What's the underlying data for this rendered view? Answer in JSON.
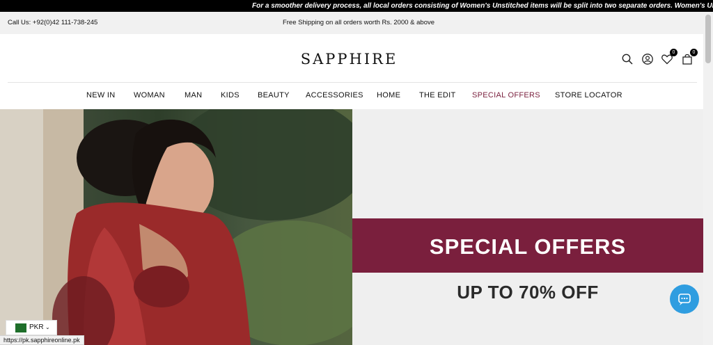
{
  "announcement": "For a smoother delivery process, all local orders consisting of Women's Unstitched items will be split into two separate orders. Women's Uns",
  "topbar": {
    "call": "Call Us: +92(0)42 111-738-245",
    "shipping": "Free Shipping on all orders worth Rs. 2000 & above"
  },
  "brand": "SAPPHIRE",
  "header_icons": {
    "wishlist_count": "0",
    "cart_count": "0"
  },
  "nav": {
    "items": [
      "NEW IN",
      "WOMAN",
      "MAN",
      "KIDS",
      "BEAUTY",
      "ACCESSORIES",
      "HOME",
      "THE EDIT",
      "SPECIAL OFFERS",
      "STORE LOCATOR"
    ]
  },
  "hero": {
    "promo_title": "SPECIAL OFFERS",
    "promo_subtitle": "UP TO 70% OFF"
  },
  "colors": {
    "accent": "#7a1f3d",
    "chat": "#2f9de0"
  },
  "currency": {
    "code": "PKR"
  },
  "status_url": "https://pk.sapphireonline.pk"
}
